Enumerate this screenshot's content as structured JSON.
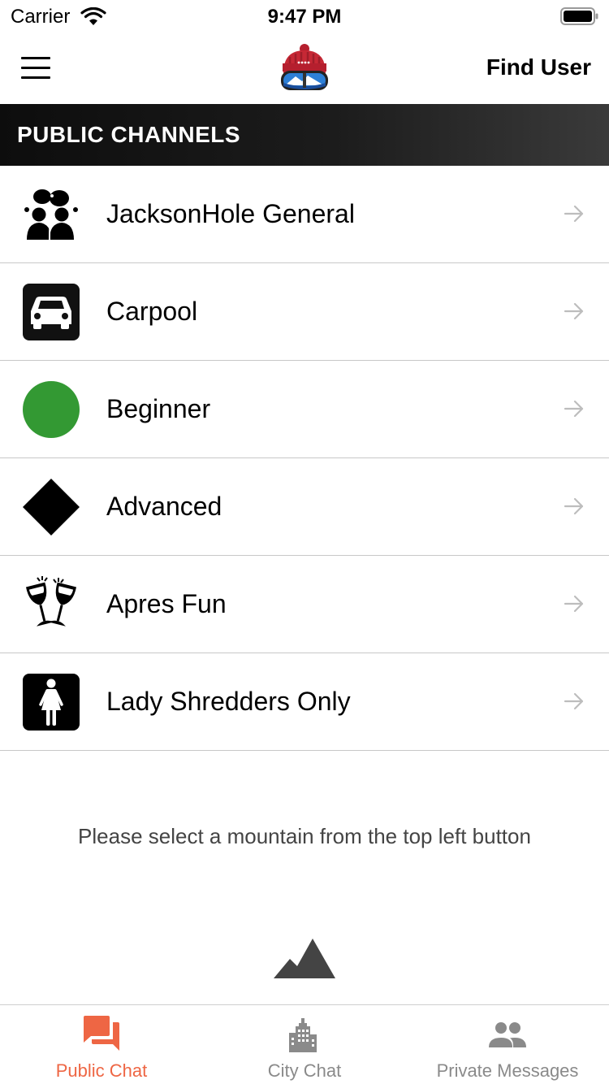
{
  "status_bar": {
    "carrier": "Carrier",
    "time": "9:47 PM"
  },
  "nav": {
    "find_user": "Find User",
    "menu_icon": "hamburger-menu-icon",
    "logo": "ski-beanie-goggles-logo"
  },
  "section": {
    "title": "PUBLIC CHANNELS"
  },
  "channels": [
    {
      "name": "JacksonHole General",
      "icon": "group-chat-icon"
    },
    {
      "name": "Carpool",
      "icon": "car-icon"
    },
    {
      "name": "Beginner",
      "icon": "green-circle-icon",
      "color": "#339933"
    },
    {
      "name": "Advanced",
      "icon": "black-diamond-icon"
    },
    {
      "name": "Apres Fun",
      "icon": "wine-toast-icon"
    },
    {
      "name": "Lady Shredders Only",
      "icon": "woman-icon"
    }
  ],
  "hint": {
    "text": "Please select a mountain from the top left button",
    "icon": "mountain-icon"
  },
  "tabs": [
    {
      "label": "Public Chat",
      "icon": "chat-bubbles-icon",
      "active": true
    },
    {
      "label": "City Chat",
      "icon": "city-buildings-icon",
      "active": false
    },
    {
      "label": "Private Messages",
      "icon": "people-icon",
      "active": false
    }
  ],
  "colors": {
    "accent": "#EE6644",
    "inactive": "#8a8a8a",
    "header_bg": "#1a1a1a",
    "separator": "#c8c8c8"
  }
}
